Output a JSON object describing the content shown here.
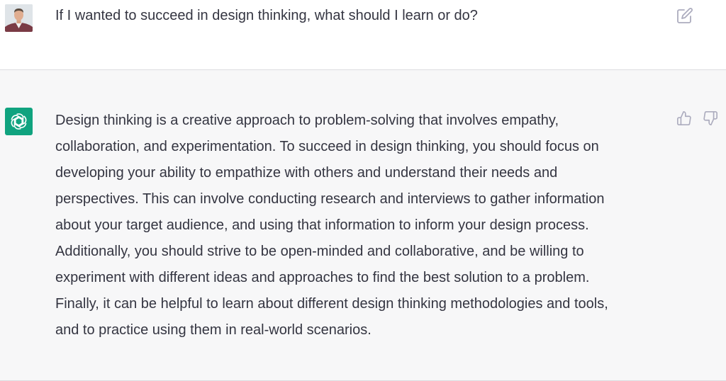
{
  "conversation": {
    "user_message": {
      "text": "If I wanted to succeed in design thinking, what should I learn or do?",
      "avatar_icon": "user-photo-avatar",
      "edit_icon": "pencil-square-icon"
    },
    "assistant_message": {
      "avatar_icon": "openai-logo-icon",
      "avatar_color": "#10a37f",
      "lines": [
        "Design thinking is a creative approach to problem-solving that involves empathy,",
        "collaboration, and experimentation. To succeed in design thinking, you should focus on",
        "developing your ability to empathize with others and understand their needs and",
        "perspectives. This can involve conducting research and interviews to gather information",
        "about your target audience, and using that information to inform your design process.",
        "Additionally, you should strive to be open-minded and collaborative, and be willing to",
        "experiment with different ideas and approaches to find the best solution to a problem.",
        "Finally, it can be helpful to learn about different design thinking methodologies and tools,",
        "and to practice using them in real-world scenarios."
      ],
      "thumbs_up_icon": "thumbs-up-icon",
      "thumbs_down_icon": "thumbs-down-icon"
    }
  }
}
